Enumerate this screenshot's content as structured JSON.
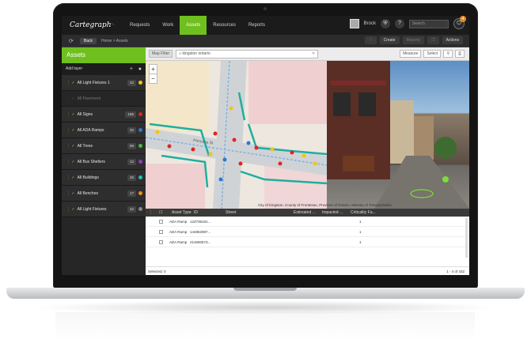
{
  "nav": {
    "logo": "Cartegraph",
    "items": [
      "Requests",
      "Work",
      "Assets",
      "Resources",
      "Reports"
    ],
    "active": "Assets",
    "user": "Brock",
    "search_placeholder": "Search",
    "notifications": "4"
  },
  "subbar": {
    "back": "Back",
    "breadcrumb": "Home > Assets",
    "create": "Create",
    "print": "Reports",
    "actions": "Actions"
  },
  "sidebar": {
    "title": "Assets",
    "add_layer": "Add layer",
    "layers": [
      {
        "label": "All Light Fixtures 1",
        "count": "42",
        "color": "#f0c419",
        "on": true
      },
      {
        "label": "All Pavement",
        "count": "",
        "color": "",
        "on": false
      },
      {
        "label": "All Signs",
        "count": "155",
        "color": "#e02424",
        "on": true
      },
      {
        "label": "All ADA Ramps",
        "count": "32",
        "color": "#2a78d6",
        "on": true
      },
      {
        "label": "All Trees",
        "count": "69",
        "color": "#3fbf3f",
        "on": true
      },
      {
        "label": "All Bus Shelters",
        "count": "12",
        "color": "#8b3fbf",
        "on": true
      },
      {
        "label": "All Buildings",
        "count": "25",
        "color": "#1fbfb0",
        "on": true
      },
      {
        "label": "All Benches",
        "count": "17",
        "color": "#f08c1c",
        "on": true
      },
      {
        "label": "All Light Fixtures",
        "count": "42",
        "color": "#888888",
        "on": true
      }
    ]
  },
  "maptool": {
    "filter": "Map Filter",
    "search_value": "kingston ontario",
    "measure": "Measure",
    "select": "Select"
  },
  "map": {
    "attribution": "City of Kingston, County of Frontenac, Province of Ontario, Ministry of Transportation",
    "street_label": "Princess St"
  },
  "grid": {
    "headers": [
      "Asset Type",
      "ID",
      "Street",
      "Estimated ...",
      "Impacted ...",
      "Criticality Fa..."
    ],
    "rows": [
      {
        "type": "ADA Ramp",
        "id": "123739191...",
        "crit": "1"
      },
      {
        "type": "ADA Ramp",
        "id": "144852987...",
        "crit": "1"
      },
      {
        "type": "ADA Ramp",
        "id": "214650573...",
        "crit": "1"
      }
    ],
    "selected": "Selected: 0",
    "paging": "1 - 4 of 432"
  }
}
